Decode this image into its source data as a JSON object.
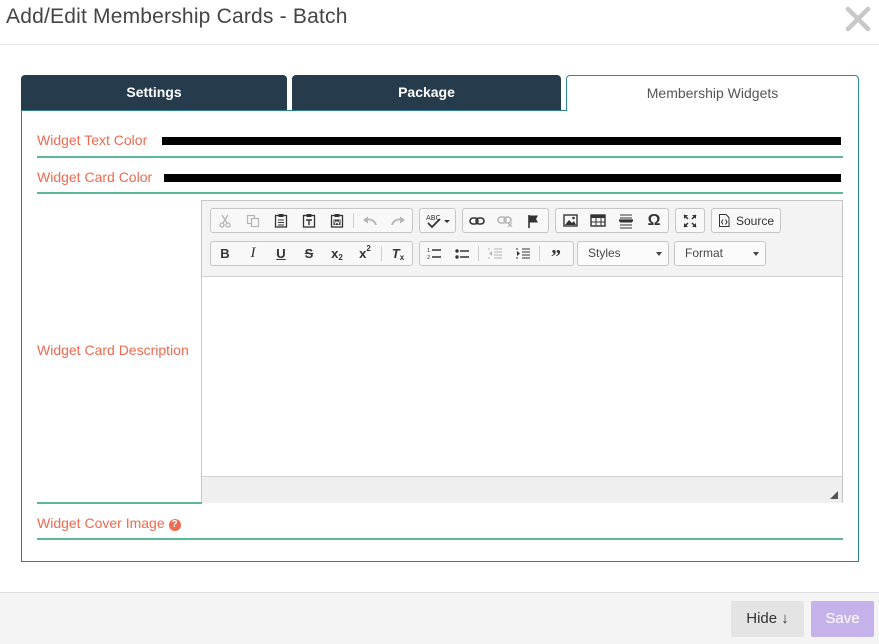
{
  "dialog": {
    "title": "Add/Edit Membership Cards - Batch",
    "close_icon": "close-icon"
  },
  "tabs": [
    {
      "label": "Settings",
      "active": false
    },
    {
      "label": "Package",
      "active": false
    },
    {
      "label": "Membership Widgets",
      "active": true
    }
  ],
  "fields": {
    "text_color_label": "Widget Text Color",
    "text_color_value": "#000000",
    "card_color_label": "Widget Card Color",
    "card_color_value": "#000000",
    "description_label": "Widget Card Description",
    "cover_image_label": "Widget Cover Image",
    "help_glyph": "?"
  },
  "editor": {
    "toolbar_row1": [
      "cut-icon",
      "copy-icon",
      "paste-icon",
      "paste-text-icon",
      "paste-word-icon",
      "undo-icon",
      "redo-icon",
      "spellcheck-icon",
      "link-icon",
      "unlink-icon",
      "anchor-icon",
      "image-icon",
      "table-icon",
      "horizontal-rule-icon",
      "special-char-icon",
      "maximize-icon",
      "source-icon"
    ],
    "source_label": "Source",
    "toolbar_row2": [
      "bold-icon",
      "italic-icon",
      "underline-icon",
      "strike-icon",
      "subscript-icon",
      "superscript-icon",
      "remove-format-icon",
      "numbered-list-icon",
      "bulleted-list-icon",
      "outdent-icon",
      "indent-icon",
      "blockquote-icon"
    ],
    "styles_label": "Styles",
    "format_label": "Format",
    "content": ""
  },
  "footer": {
    "hide_label": "Hide ↓",
    "save_label": "Save"
  },
  "colors": {
    "accent_label": "#ef6a50",
    "tab_dark": "#263b4b",
    "rule": "#5cb89a",
    "save_disabled": "#c5b2ea"
  }
}
